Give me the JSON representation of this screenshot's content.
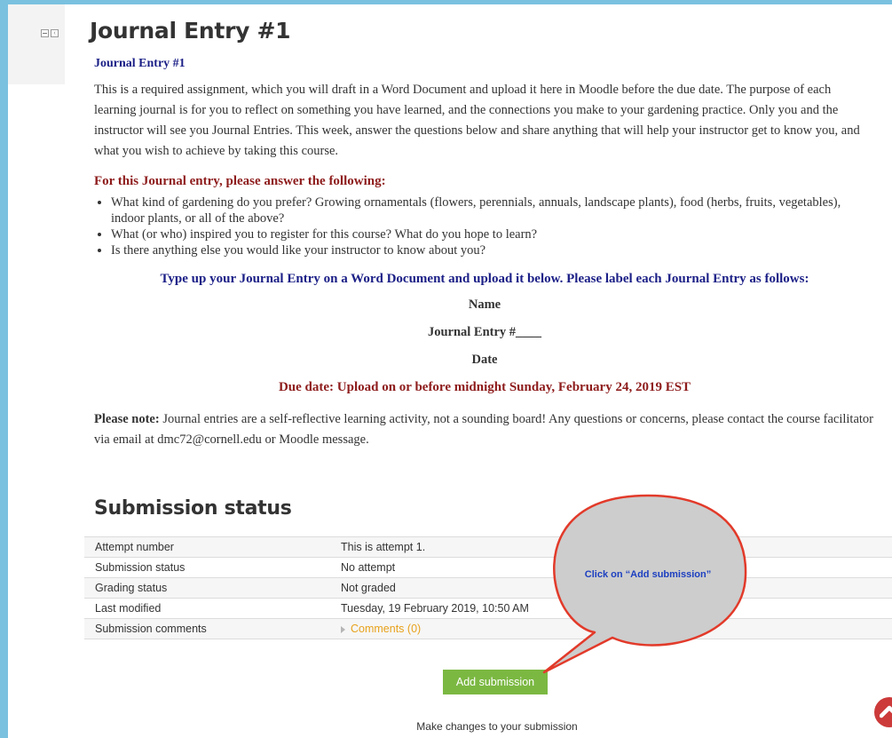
{
  "block_controls": {
    "dock_icon": "minimize-icon",
    "collapse_icon": "chevron-left-icon"
  },
  "page": {
    "title": "Journal Entry #1"
  },
  "intro": {
    "subheading": "Journal Entry #1",
    "paragraph": "This is a required assignment, which you will draft in a Word Document and upload it here in Moodle before the due date. The purpose of each learning journal is for you to reflect on something you have learned, and the connections you make to your gardening practice. Only you and the instructor will see you Journal Entries. This week, answer the questions below and share anything that will help your instructor get to know you, and what you wish to achieve by taking this course.",
    "questions_heading": "For this Journal entry, please answer the following:",
    "questions": [
      "What kind of gardening do you prefer? Growing ornamentals (flowers, perennials, annuals, landscape plants), food (herbs, fruits, vegetables), indoor plants, or all of the above?",
      "What (or who) inspired you to register for this course? What do you hope to learn?",
      "Is there anything else you would like your instructor to know about you?"
    ],
    "instruction": "Type up your Journal Entry on a Word Document and upload it below. Please label each Journal Entry as follows:",
    "label_lines": [
      "Name",
      "Journal Entry #____",
      "Date"
    ],
    "due_date": "Due date: Upload on or before midnight Sunday, February 24, 2019 EST",
    "note_label": "Please note:",
    "note_text": " Journal entries are a self-reflective learning activity, not a sounding board! Any questions or concerns, please contact the course facilitator via email at dmc72@cornell.edu or Moodle message."
  },
  "submission": {
    "heading": "Submission status",
    "rows": [
      {
        "label": "Attempt number",
        "value": "This is attempt 1."
      },
      {
        "label": "Submission status",
        "value": "No attempt"
      },
      {
        "label": "Grading status",
        "value": "Not graded"
      },
      {
        "label": "Last modified",
        "value": "Tuesday, 19 February 2019, 10:50 AM"
      },
      {
        "label": "Submission comments",
        "value": "Comments (0)"
      }
    ],
    "add_button": "Add submission",
    "make_changes": "Make changes to your submission"
  },
  "callout": {
    "text": "Click on “Add submission”"
  },
  "colors": {
    "accent_blue": "#1b1f86",
    "accent_red": "#8e1c1c",
    "button_green": "#7bb842",
    "link_orange": "#e8a21c",
    "frame_blue": "#7ac1e0"
  },
  "scroll_top_icon": "chevron-up-icon"
}
